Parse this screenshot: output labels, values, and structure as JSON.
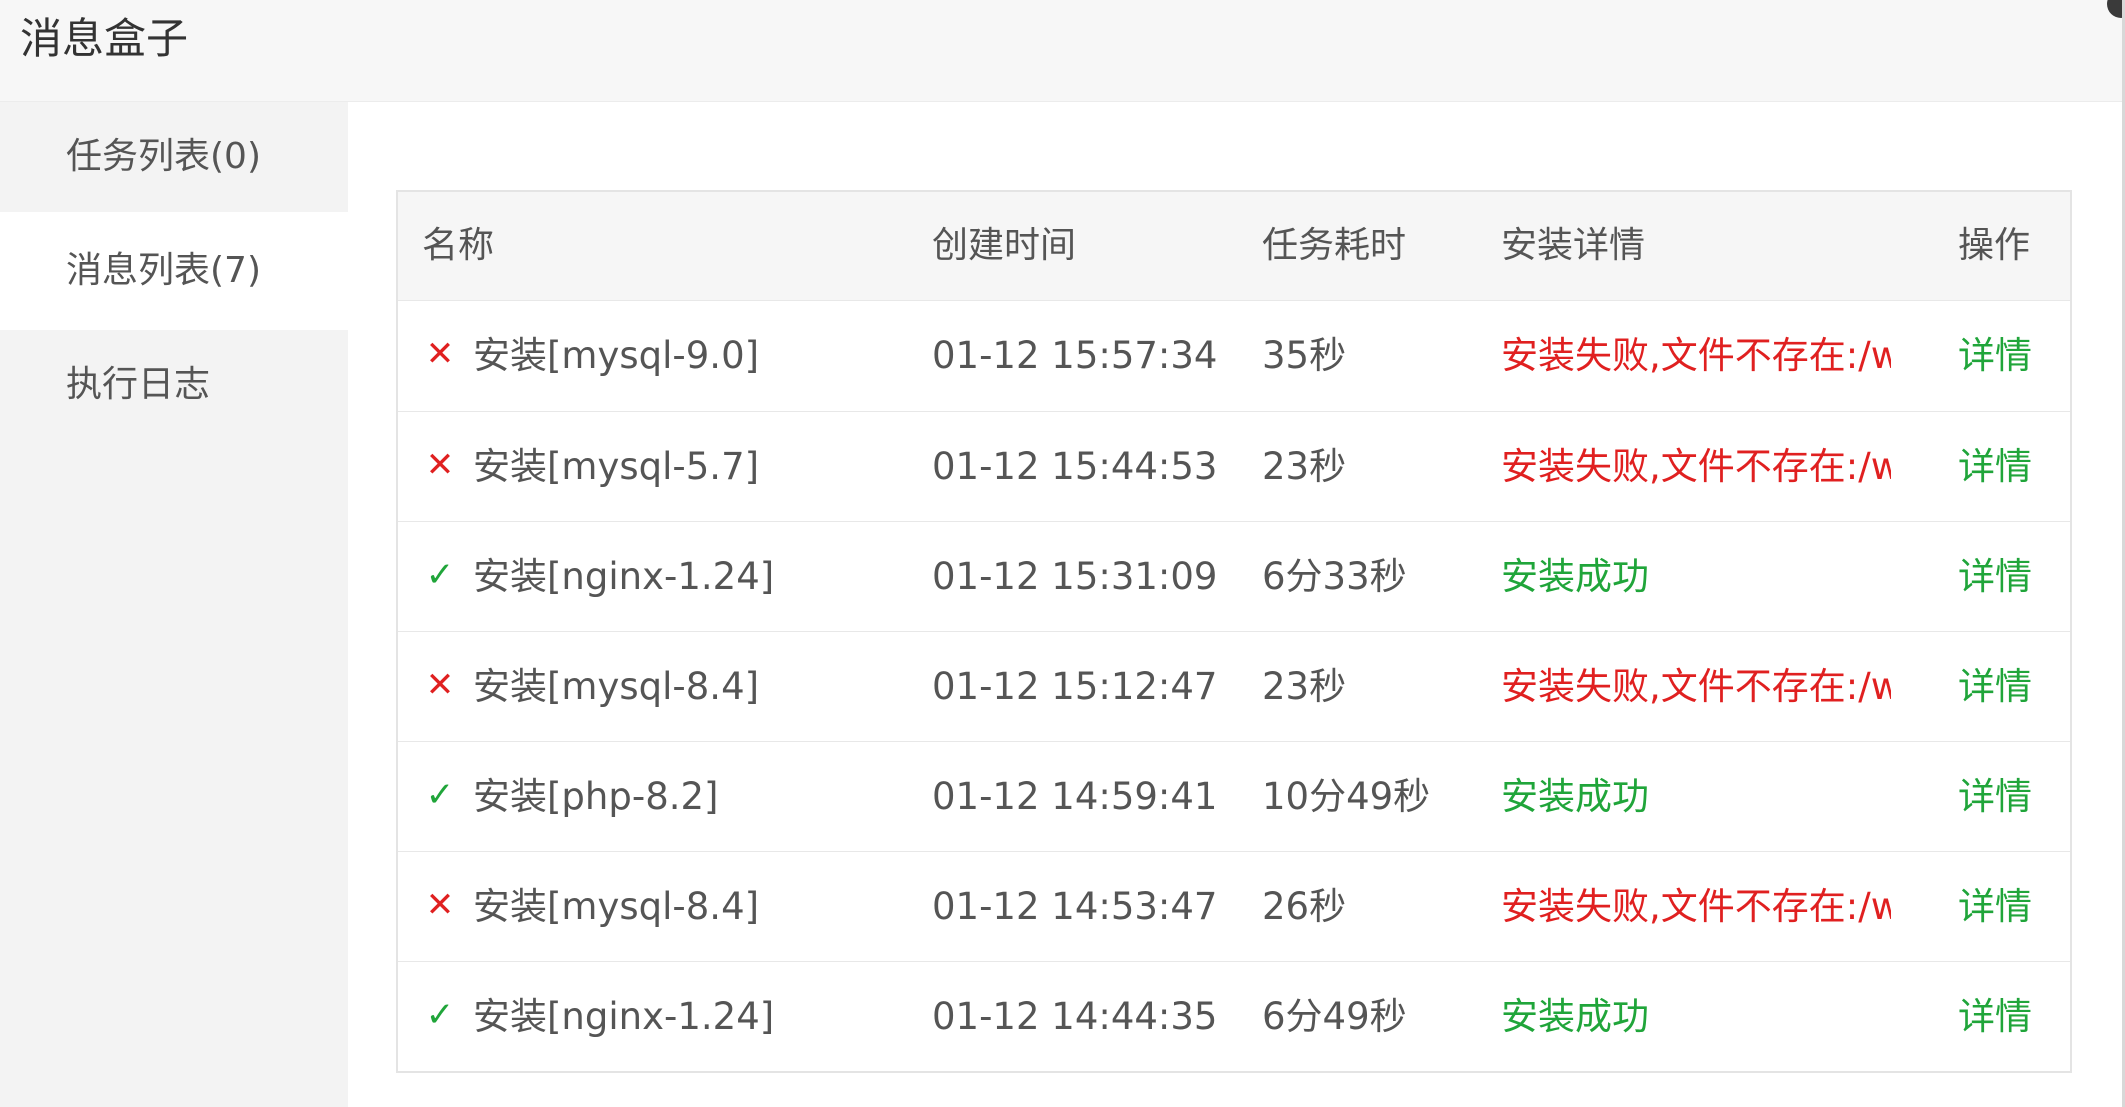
{
  "window": {
    "title": "消息盒子"
  },
  "sidebar": {
    "items": [
      {
        "label": "任务列表(0)",
        "active": false
      },
      {
        "label": "消息列表(7)",
        "active": true
      },
      {
        "label": "执行日志",
        "active": false
      }
    ]
  },
  "table": {
    "headers": {
      "name": "名称",
      "created": "创建时间",
      "duration": "任务耗时",
      "detail": "安装详情",
      "action": "操作"
    },
    "rows": [
      {
        "status": "fail",
        "icon": "close-icon",
        "name": "安装[mysql-9.0]",
        "created": "01-12 15:57:34",
        "duration": "35秒",
        "detail": "安装失败,文件不存在:/www",
        "action": "详情"
      },
      {
        "status": "fail",
        "icon": "close-icon",
        "name": "安装[mysql-5.7]",
        "created": "01-12 15:44:53",
        "duration": "23秒",
        "detail": "安装失败,文件不存在:/www",
        "action": "详情"
      },
      {
        "status": "ok",
        "icon": "check-icon",
        "name": "安装[nginx-1.24]",
        "created": "01-12 15:31:09",
        "duration": "6分33秒",
        "detail": "安装成功",
        "action": "详情"
      },
      {
        "status": "fail",
        "icon": "close-icon",
        "name": "安装[mysql-8.4]",
        "created": "01-12 15:12:47",
        "duration": "23秒",
        "detail": "安装失败,文件不存在:/www",
        "action": "详情"
      },
      {
        "status": "ok",
        "icon": "check-icon",
        "name": "安装[php-8.2]",
        "created": "01-12 14:59:41",
        "duration": "10分49秒",
        "detail": "安装成功",
        "action": "详情"
      },
      {
        "status": "fail",
        "icon": "close-icon",
        "name": "安装[mysql-8.4]",
        "created": "01-12 14:53:47",
        "duration": "26秒",
        "detail": "安装失败,文件不存在:/www",
        "action": "详情"
      },
      {
        "status": "ok",
        "icon": "check-icon",
        "name": "安装[nginx-1.24]",
        "created": "01-12 14:44:35",
        "duration": "6分49秒",
        "detail": "安装成功",
        "action": "详情"
      }
    ]
  },
  "colors": {
    "success": "#20a53a",
    "error": "#e02020",
    "sidebar_bg": "#f3f3f3",
    "header_bg": "#f6f6f6"
  }
}
